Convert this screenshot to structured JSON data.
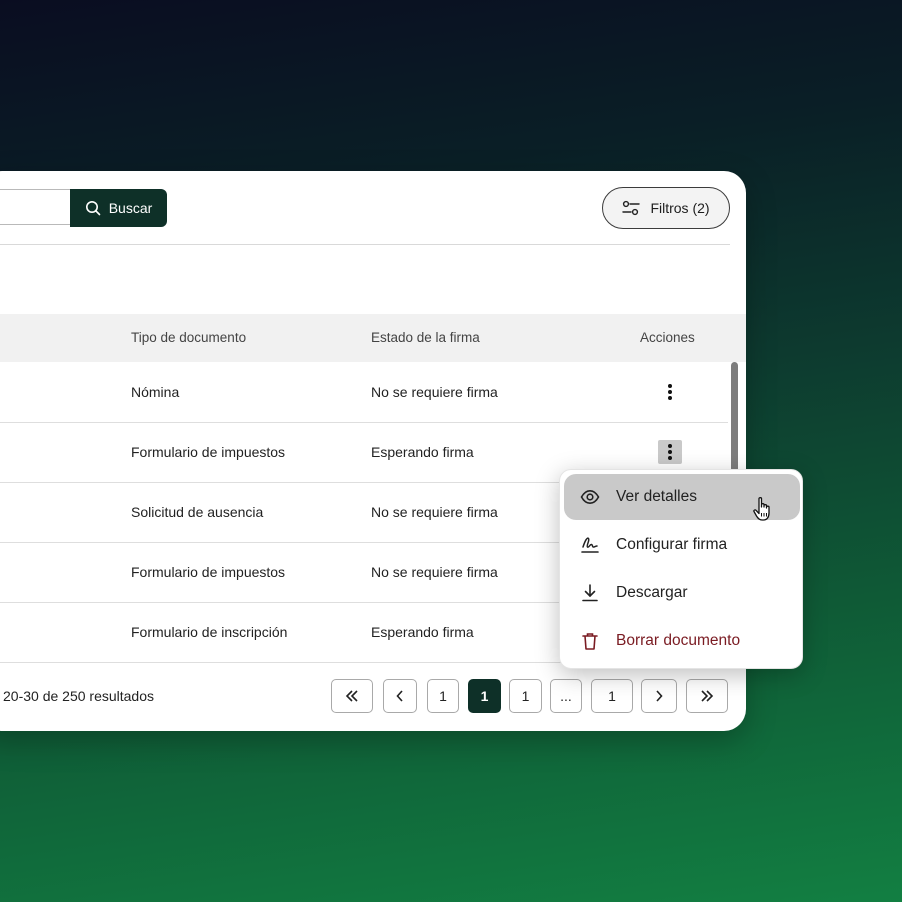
{
  "toolbar": {
    "search_label": "Buscar",
    "filters_label": "Filtros (2)"
  },
  "table": {
    "columns": [
      "Tipo de documento",
      "Estado de la firma",
      "Acciones"
    ],
    "rows": [
      {
        "tipo": "Nómina",
        "estado": "No se requiere firma"
      },
      {
        "tipo": "Formulario de impuestos",
        "estado": "Esperando firma"
      },
      {
        "tipo": "Solicitud de ausencia",
        "estado": "No se requiere firma"
      },
      {
        "tipo": "Formulario de impuestos",
        "estado": "No se requiere firma"
      },
      {
        "tipo": "Formulario de inscripción",
        "estado": "Esperando firma"
      }
    ]
  },
  "pagination": {
    "results_text": "20-30 de 250 resultados",
    "first": "«",
    "prev": "‹",
    "pages": [
      "1",
      "1",
      "1",
      "...",
      "1"
    ],
    "current_index": 1,
    "next": "›",
    "last": "»"
  },
  "menu": {
    "items": [
      {
        "label": "Ver detalles",
        "icon": "eye-icon"
      },
      {
        "label": "Configurar firma",
        "icon": "signature-icon"
      },
      {
        "label": "Descargar",
        "icon": "download-icon"
      },
      {
        "label": "Borrar documento",
        "icon": "trash-icon"
      }
    ]
  },
  "colors": {
    "primary": "#0e3028",
    "danger": "#7a1b22",
    "hover": "#c9c9c9"
  }
}
